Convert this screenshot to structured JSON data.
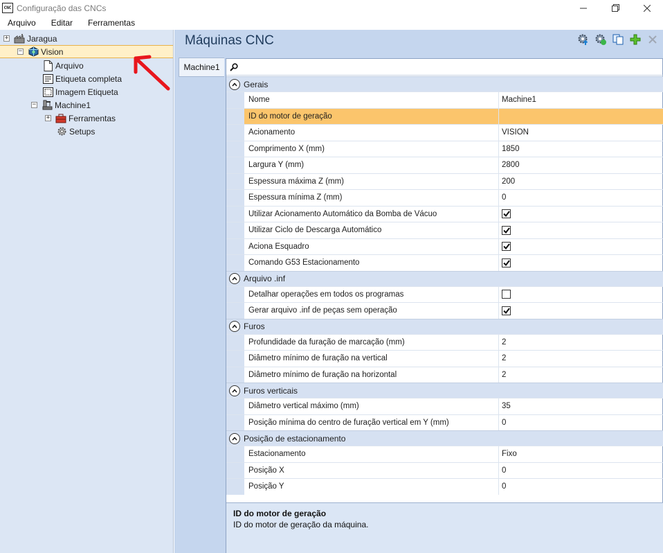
{
  "window": {
    "title": "Configuração das CNCs",
    "app_icon_text": "CNC"
  },
  "menu": [
    "Arquivo",
    "Editar",
    "Ferramentas"
  ],
  "tree": {
    "root": "Jaragua",
    "vision": "Vision",
    "arquivo": "Arquivo",
    "etiqueta_completa": "Etiqueta completa",
    "imagem_etiqueta": "Imagem Etiqueta",
    "machine": "Machine1",
    "ferramentas": "Ferramentas",
    "setups": "Setups"
  },
  "main": {
    "title": "Máquinas CNC",
    "tab": "Machine1"
  },
  "grid": {
    "gerais": {
      "label": "Gerais",
      "rows": [
        {
          "name": "Nome",
          "value": "Machine1"
        },
        {
          "name": "ID do motor de geração",
          "value": ""
        },
        {
          "name": "Acionamento",
          "value": "VISION"
        },
        {
          "name": "Comprimento X (mm)",
          "value": "1850"
        },
        {
          "name": "Largura Y (mm)",
          "value": "2800"
        },
        {
          "name": "Espessura máxima Z (mm)",
          "value": "200"
        },
        {
          "name": "Espessura mínima Z (mm)",
          "value": "0"
        },
        {
          "name": "Utilizar Acionamento Automático da Bomba de Vácuo",
          "checked": true
        },
        {
          "name": "Utilizar Ciclo de Descarga Automático",
          "checked": true
        },
        {
          "name": "Aciona Esquadro",
          "checked": true
        },
        {
          "name": "Comando G53 Estacionamento",
          "checked": true
        }
      ]
    },
    "arquivo_inf": {
      "label": "Arquivo .inf",
      "rows": [
        {
          "name": "Detalhar operações em todos os programas",
          "checked": false
        },
        {
          "name": "Gerar arquivo .inf de peças sem operação",
          "checked": true
        }
      ]
    },
    "furos": {
      "label": "Furos",
      "rows": [
        {
          "name": "Profundidade da furação de marcação (mm)",
          "value": "2"
        },
        {
          "name": "Diâmetro mínimo de furação na vertical",
          "value": "2"
        },
        {
          "name": "Diâmetro mínimo de furação na horizontal",
          "value": "2"
        }
      ]
    },
    "furos_verticais": {
      "label": "Furos verticais",
      "rows": [
        {
          "name": "Diâmetro vertical máximo (mm)",
          "value": "35"
        },
        {
          "name": "Posição mínima do centro de furação vertical em Y (mm)",
          "value": "0"
        }
      ]
    },
    "estacionamento": {
      "label": "Posição de estacionamento",
      "rows": [
        {
          "name": "Estacionamento",
          "value": "Fixo"
        },
        {
          "name": "Posição X",
          "value": "0"
        },
        {
          "name": "Posição Y",
          "value": "0"
        }
      ]
    }
  },
  "description": {
    "title": "ID do motor de geração",
    "text": "ID do motor de geração da máquina."
  },
  "colors": {
    "highlight": "#fbc56c",
    "tree_bg": "#dce6f4",
    "main_bg": "#c5d6ee",
    "arrow": "#e8161d"
  }
}
